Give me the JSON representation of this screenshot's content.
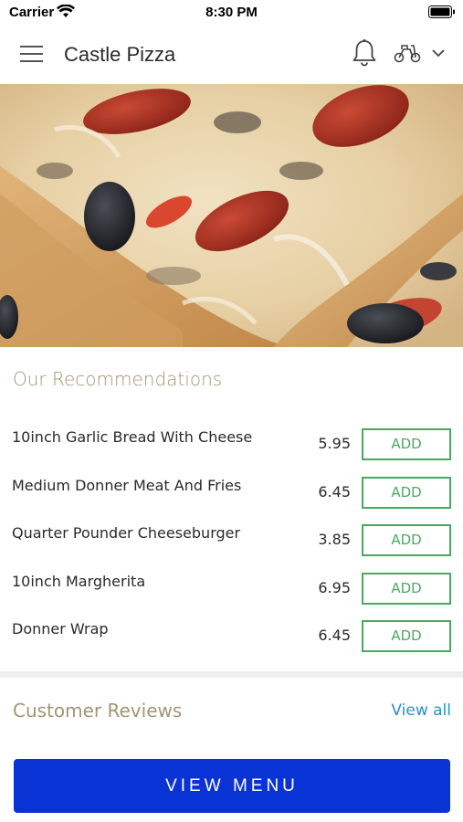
{
  "status_bar": {
    "carrier": "Carrier",
    "time": "8:30 PM"
  },
  "header": {
    "title": "Castle Pizza",
    "icons": [
      "menu-icon",
      "bell-icon",
      "scooter-icon",
      "chevron-down-icon"
    ]
  },
  "hero": {
    "image": "pizza-photo"
  },
  "recommendations": {
    "title": "Our Recommendations",
    "items": [
      {
        "name": "10inch Garlic Bread With Cheese",
        "price": "5.95",
        "button": "ADD"
      },
      {
        "name": "Medium Donner Meat And Fries",
        "price": "6.45",
        "button": "ADD"
      },
      {
        "name": "Quarter Pounder Cheeseburger",
        "price": "3.85",
        "button": "ADD"
      },
      {
        "name": "10inch Margherita",
        "price": "6.95",
        "button": "ADD"
      },
      {
        "name": "Donner Wrap",
        "price": "6.45",
        "button": "ADD"
      }
    ]
  },
  "reviews": {
    "title": "Customer Reviews",
    "view_all": "View all"
  },
  "footer": {
    "view_menu": "VIEW MENU"
  },
  "colors": {
    "accent_gold": "#a39574",
    "add_green": "#4aa860",
    "link_blue": "#2b8fc1",
    "primary_button": "#0a33d6"
  }
}
